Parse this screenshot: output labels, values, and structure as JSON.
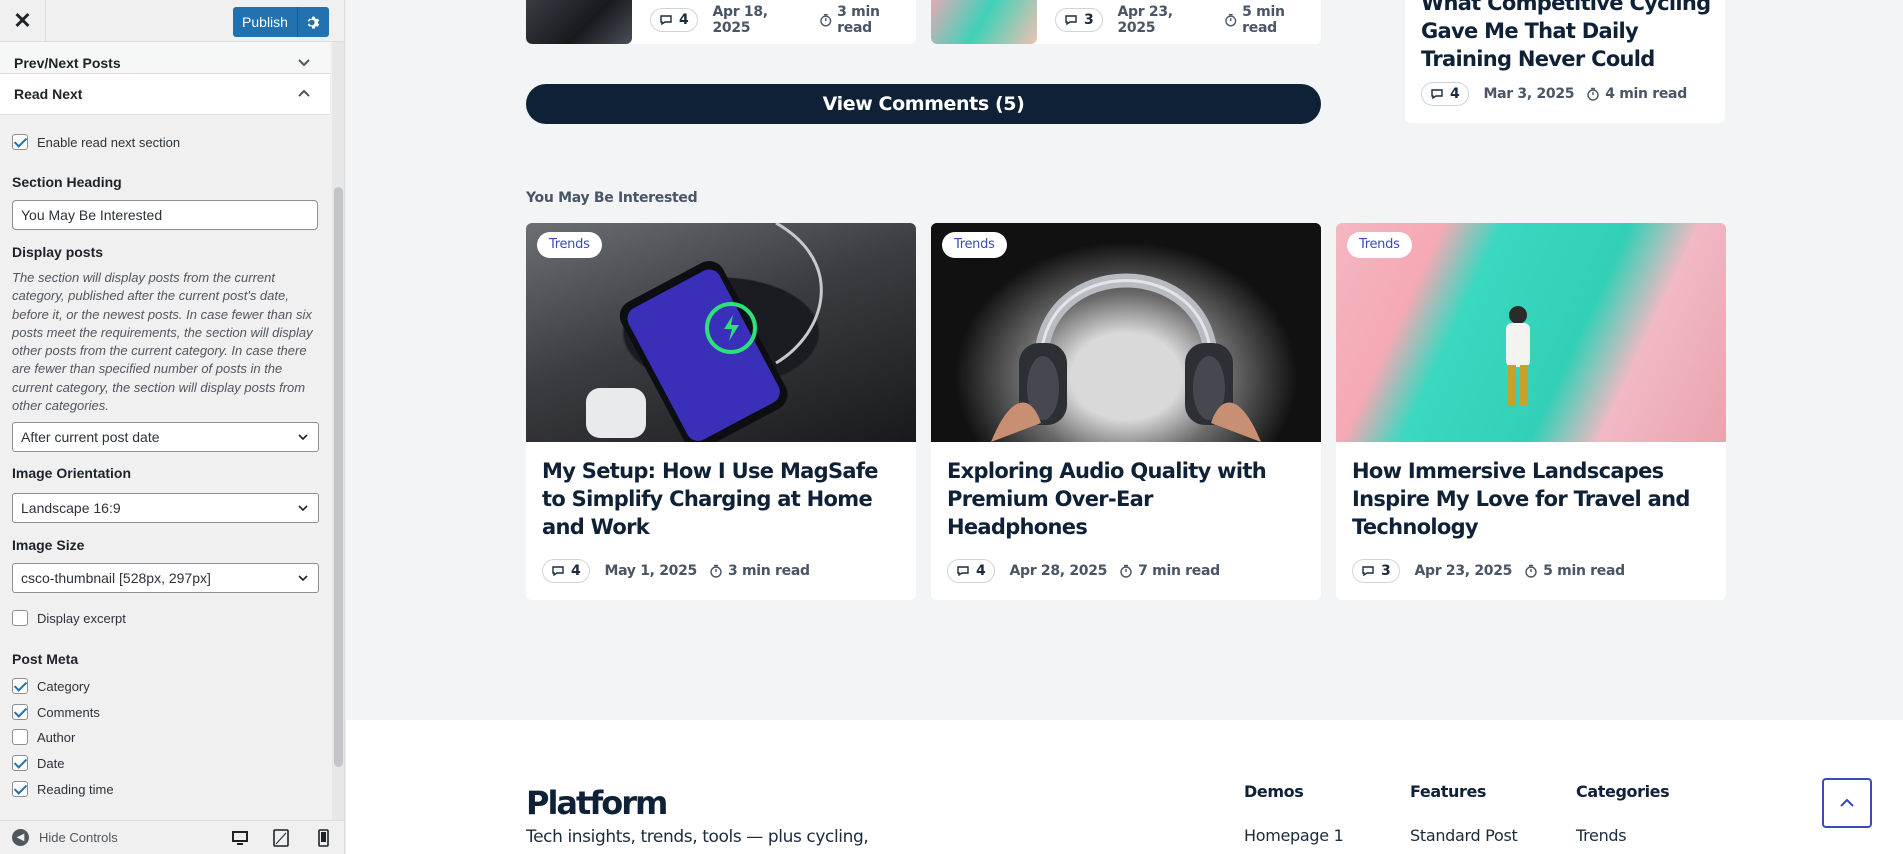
{
  "panel": {
    "close_label": "✕",
    "publish_label": "Publish",
    "sections": {
      "prev_next": "Prev/Next Posts",
      "read_next": "Read Next"
    },
    "enable_read_next": {
      "label": "Enable read next section",
      "checked": true
    },
    "section_heading": {
      "label": "Section Heading",
      "value": "You May Be Interested"
    },
    "display_posts": {
      "label": "Display posts",
      "description": "The section will display posts from the current category, published after the current post's date, before it, or the newest posts. In case fewer than six posts meet the requirements, the section will display other posts from the current category. In case there are fewer than specified number of posts in the current category, the section will display posts from other categories.",
      "selected": "After current post date"
    },
    "image_orientation": {
      "label": "Image Orientation",
      "selected": "Landscape 16:9"
    },
    "image_size": {
      "label": "Image Size",
      "selected": "csco-thumbnail [528px, 297px]"
    },
    "display_excerpt": {
      "label": "Display excerpt",
      "checked": false
    },
    "post_meta": {
      "label": "Post Meta",
      "items": [
        {
          "label": "Category",
          "checked": true
        },
        {
          "label": "Comments",
          "checked": true
        },
        {
          "label": "Author",
          "checked": false
        },
        {
          "label": "Date",
          "checked": true
        },
        {
          "label": "Reading time",
          "checked": true
        }
      ]
    },
    "footer": {
      "hide_controls": "Hide Controls"
    }
  },
  "preview": {
    "top_cards": [
      {
        "comments": "4",
        "date": "Apr 18, 2025",
        "read": "3 min read"
      },
      {
        "comments": "3",
        "date": "Apr 23, 2025",
        "read": "5 min read"
      }
    ],
    "side_card": {
      "title": "What Competitive Cycling Gave Me That Daily Training Never Could",
      "comments": "4",
      "date": "Mar 3, 2025",
      "read": "4 min read"
    },
    "view_comments": "View Comments (5)",
    "read_next_heading": "You May Be Interested",
    "read_next_posts": [
      {
        "badge": "Trends",
        "title": "My Setup: How I Use MagSafe to Simplify Charging at Home and Work",
        "comments": "4",
        "date": "May 1, 2025",
        "read": "3 min read"
      },
      {
        "badge": "Trends",
        "title": "Exploring Audio Quality with Premium Over-Ear Headphones",
        "comments": "4",
        "date": "Apr 28, 2025",
        "read": "7 min read"
      },
      {
        "badge": "Trends",
        "title": "How Immersive Landscapes Inspire My Love for Travel and Technology",
        "comments": "3",
        "date": "Apr 23, 2025",
        "read": "5 min read"
      }
    ],
    "footer": {
      "logo": "Platform",
      "description": "Tech insights, trends, tools — plus cycling,",
      "columns": [
        {
          "heading": "Demos",
          "first_link": "Homepage 1"
        },
        {
          "heading": "Features",
          "first_link": "Standard Post"
        },
        {
          "heading": "Categories",
          "first_link": "Trends"
        }
      ]
    }
  },
  "colors": {
    "accent": "#2271b1",
    "dark": "#0f2136",
    "badge_text": "#3b4bb8"
  }
}
